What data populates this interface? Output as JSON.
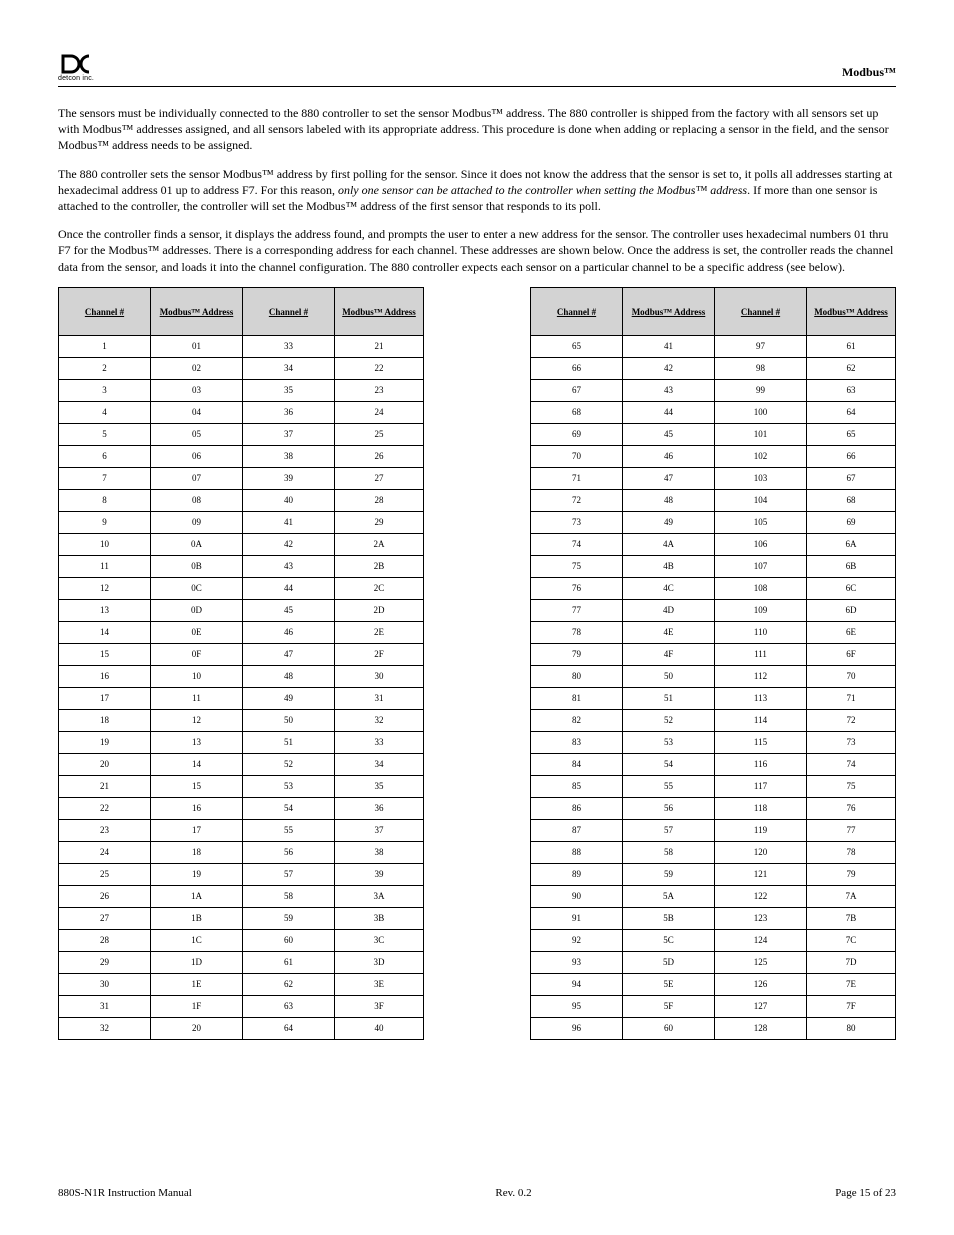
{
  "header": {
    "logo_caption": "detcon inc.",
    "modbus_name": "Modbus™"
  },
  "intro": {
    "p1": "The sensors must be individually connected to the 880 controller to set the sensor Modbus™ address.  The 880 controller is shipped from the factory with all sensors set up with Modbus™ addresses assigned, and all sensors labeled with its appropriate address.  This procedure is done when adding or replacing a sensor in the field, and the sensor Modbus™ address needs to be assigned.",
    "p2a": "The 880 controller sets the sensor Modbus™ address by first polling for the sensor.  Since it does not know the address that the sensor is set to, it polls all addresses starting at hexadecimal address 01 up to address F7.  For this reason, ",
    "p2b": "only one sensor can be attached to the controller when setting the Modbus™ address",
    "p2c": ".  If more than one sensor is attached to the controller, the controller will set the Modbus™ address of the first sensor that responds to its poll.",
    "p3": "Once the controller finds a sensor, it displays the address found, and prompts the user to enter a new address for the sensor.  The controller uses hexadecimal numbers 01 thru F7 for the Modbus™ addresses.  There is a corresponding address for each channel.  These addresses are shown below.  Once the address is set, the controller reads the channel data from the sensor, and loads it into the channel configuration.  The 880 controller expects each sensor on a particular channel to be a specific address (see below)."
  },
  "tables": {
    "t1": {
      "headers": [
        "Channel #",
        "Modbus™ Address",
        "Channel #",
        "Modbus™ Address"
      ],
      "rows": [
        [
          "1",
          "01",
          "33",
          "21"
        ],
        [
          "2",
          "02",
          "34",
          "22"
        ],
        [
          "3",
          "03",
          "35",
          "23"
        ],
        [
          "4",
          "04",
          "36",
          "24"
        ],
        [
          "5",
          "05",
          "37",
          "25"
        ],
        [
          "6",
          "06",
          "38",
          "26"
        ],
        [
          "7",
          "07",
          "39",
          "27"
        ],
        [
          "8",
          "08",
          "40",
          "28"
        ],
        [
          "9",
          "09",
          "41",
          "29"
        ],
        [
          "10",
          "0A",
          "42",
          "2A"
        ],
        [
          "11",
          "0B",
          "43",
          "2B"
        ],
        [
          "12",
          "0C",
          "44",
          "2C"
        ],
        [
          "13",
          "0D",
          "45",
          "2D"
        ],
        [
          "14",
          "0E",
          "46",
          "2E"
        ],
        [
          "15",
          "0F",
          "47",
          "2F"
        ],
        [
          "16",
          "10",
          "48",
          "30"
        ],
        [
          "17",
          "11",
          "49",
          "31"
        ],
        [
          "18",
          "12",
          "50",
          "32"
        ],
        [
          "19",
          "13",
          "51",
          "33"
        ],
        [
          "20",
          "14",
          "52",
          "34"
        ],
        [
          "21",
          "15",
          "53",
          "35"
        ],
        [
          "22",
          "16",
          "54",
          "36"
        ],
        [
          "23",
          "17",
          "55",
          "37"
        ],
        [
          "24",
          "18",
          "56",
          "38"
        ],
        [
          "25",
          "19",
          "57",
          "39"
        ],
        [
          "26",
          "1A",
          "58",
          "3A"
        ],
        [
          "27",
          "1B",
          "59",
          "3B"
        ],
        [
          "28",
          "1C",
          "60",
          "3C"
        ],
        [
          "29",
          "1D",
          "61",
          "3D"
        ],
        [
          "30",
          "1E",
          "62",
          "3E"
        ],
        [
          "31",
          "1F",
          "63",
          "3F"
        ],
        [
          "32",
          "20",
          "64",
          "40"
        ]
      ]
    },
    "t2": {
      "headers": [
        "Channel #",
        "Modbus™ Address",
        "Channel #",
        "Modbus™ Address"
      ],
      "rows": [
        [
          "65",
          "41",
          "97",
          "61"
        ],
        [
          "66",
          "42",
          "98",
          "62"
        ],
        [
          "67",
          "43",
          "99",
          "63"
        ],
        [
          "68",
          "44",
          "100",
          "64"
        ],
        [
          "69",
          "45",
          "101",
          "65"
        ],
        [
          "70",
          "46",
          "102",
          "66"
        ],
        [
          "71",
          "47",
          "103",
          "67"
        ],
        [
          "72",
          "48",
          "104",
          "68"
        ],
        [
          "73",
          "49",
          "105",
          "69"
        ],
        [
          "74",
          "4A",
          "106",
          "6A"
        ],
        [
          "75",
          "4B",
          "107",
          "6B"
        ],
        [
          "76",
          "4C",
          "108",
          "6C"
        ],
        [
          "77",
          "4D",
          "109",
          "6D"
        ],
        [
          "78",
          "4E",
          "110",
          "6E"
        ],
        [
          "79",
          "4F",
          "111",
          "6F"
        ],
        [
          "80",
          "50",
          "112",
          "70"
        ],
        [
          "81",
          "51",
          "113",
          "71"
        ],
        [
          "82",
          "52",
          "114",
          "72"
        ],
        [
          "83",
          "53",
          "115",
          "73"
        ],
        [
          "84",
          "54",
          "116",
          "74"
        ],
        [
          "85",
          "55",
          "117",
          "75"
        ],
        [
          "86",
          "56",
          "118",
          "76"
        ],
        [
          "87",
          "57",
          "119",
          "77"
        ],
        [
          "88",
          "58",
          "120",
          "78"
        ],
        [
          "89",
          "59",
          "121",
          "79"
        ],
        [
          "90",
          "5A",
          "122",
          "7A"
        ],
        [
          "91",
          "5B",
          "123",
          "7B"
        ],
        [
          "92",
          "5C",
          "124",
          "7C"
        ],
        [
          "93",
          "5D",
          "125",
          "7D"
        ],
        [
          "94",
          "5E",
          "126",
          "7E"
        ],
        [
          "95",
          "5F",
          "127",
          "7F"
        ],
        [
          "96",
          "60",
          "128",
          "80"
        ]
      ]
    }
  },
  "footer": {
    "left": "880S-N1R Instruction Manual",
    "center": "Rev. 0.2",
    "right": "Page 15 of 23"
  }
}
